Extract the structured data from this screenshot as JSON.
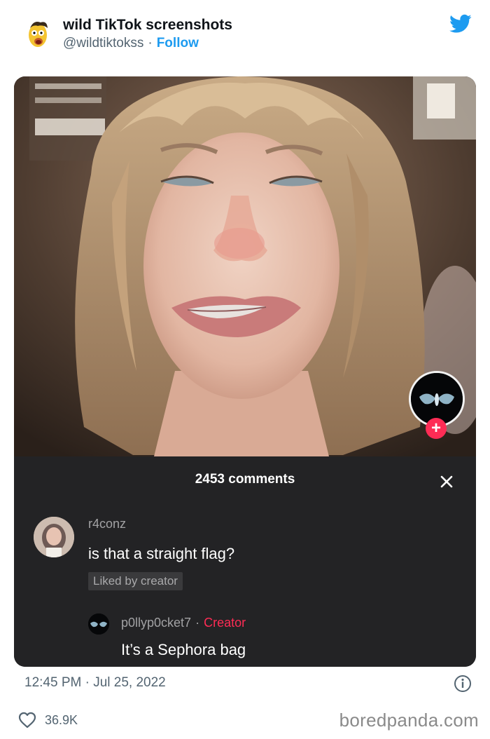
{
  "tweet": {
    "account_name": "wild TikTok screenshots",
    "handle": "@wildtiktokss",
    "separator": "·",
    "follow_label": "Follow",
    "timestamp": "12:45 PM · Jul 25, 2022",
    "likes": "36.9K"
  },
  "tiktok": {
    "comments_count": "2453 comments",
    "comment": {
      "username": "r4conz",
      "text": "is that a straight flag?",
      "badge": "Liked by creator"
    },
    "reply": {
      "username": "p0llyp0cket7",
      "separator": "·",
      "creator_label": "Creator",
      "text": "It’s a Sephora bag"
    },
    "follow_plus": "+"
  },
  "watermark": "boredpanda.com",
  "colors": {
    "twitter_blue": "#1d9bf0",
    "tiktok_red": "#fe2c55",
    "panel_bg": "#232325"
  }
}
